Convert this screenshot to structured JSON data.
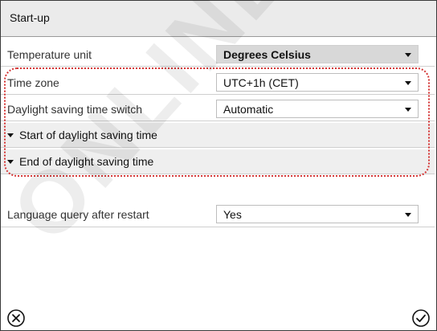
{
  "window": {
    "title": "Start-up"
  },
  "settings": {
    "temperature_unit": {
      "label": "Temperature unit",
      "value": "Degrees Celsius"
    },
    "time_zone": {
      "label": "Time zone",
      "value": "UTC+1h (CET)"
    },
    "dst_switch": {
      "label": "Daylight saving time switch",
      "value": "Automatic"
    },
    "dst_start": {
      "label": "Start of daylight saving time"
    },
    "dst_end": {
      "label": "End of daylight saving time"
    },
    "language_query": {
      "label": "Language query after restart",
      "value": "Yes"
    }
  },
  "footer": {
    "cancel_icon": "circled-x-icon",
    "confirm_icon": "circled-check-icon"
  },
  "watermark": {
    "text": "ONLINE"
  },
  "colors": {
    "highlight": "#d43535",
    "title_bg": "#ebebeb",
    "row_shade": "#efefef"
  }
}
